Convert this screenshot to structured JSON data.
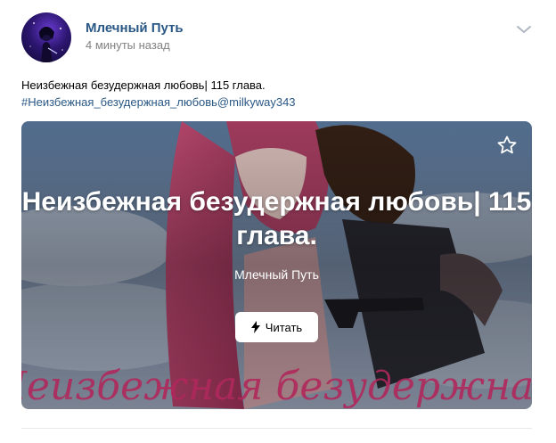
{
  "post": {
    "author": "Млечный Путь",
    "time": "4 минуты назад",
    "text": "Неизбежная безудержная любовь| 115 глава.",
    "hashtag": "#Неизбежная_безудержная_любовь@milkyway343"
  },
  "card": {
    "title": "Неизбежная безудержная любовь| 115 глава.",
    "subtitle": "Млечный Путь",
    "read_label": "Читать",
    "cover_lettering": "Неизбежная безудержная"
  },
  "icons": {
    "menu": "chevron-down-icon",
    "favorite": "star-icon",
    "read": "lightning-icon"
  },
  "colors": {
    "link": "#2a5885",
    "muted": "#828282",
    "divider": "#e7e8ec"
  }
}
